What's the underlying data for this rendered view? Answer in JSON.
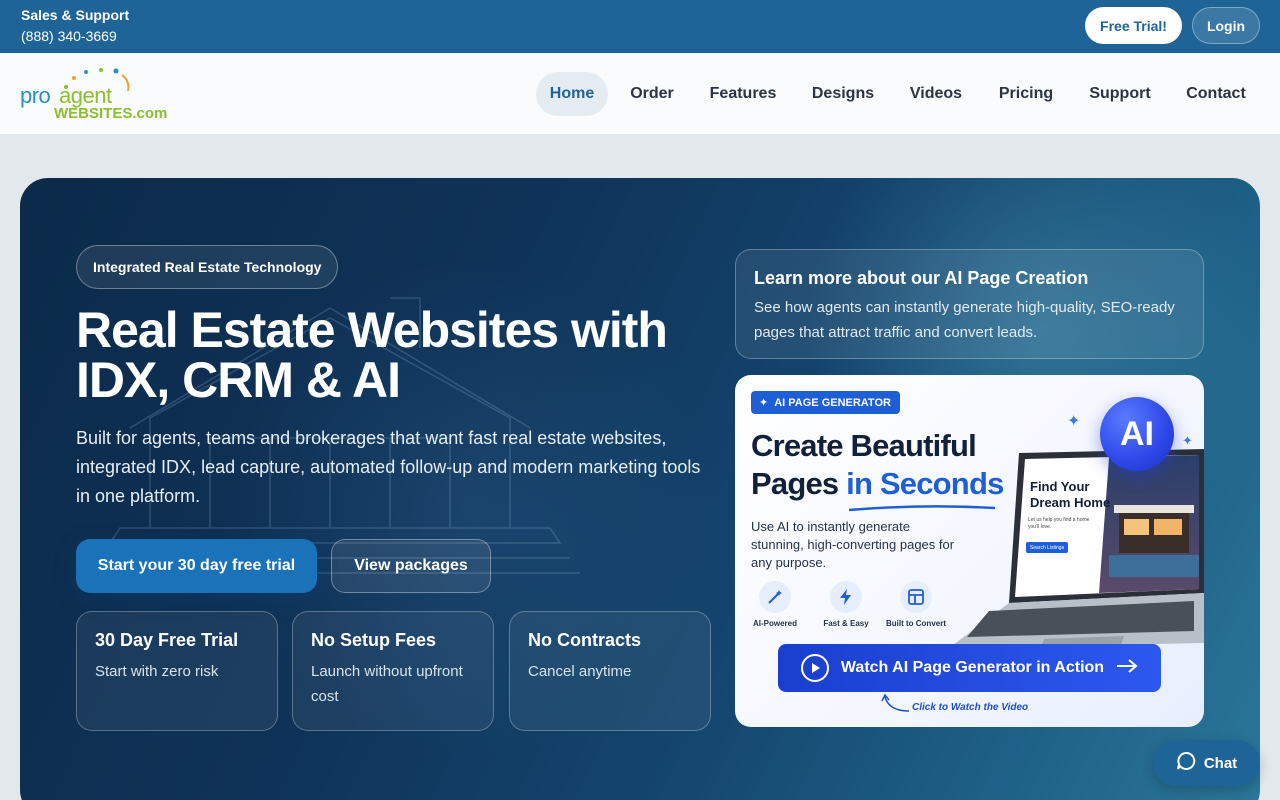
{
  "topbar": {
    "sales_label": "Sales & Support",
    "phone": "(888) 340-3669",
    "trial_button": "Free Trial!",
    "login_button": "Login"
  },
  "logo": {
    "pro": "pro",
    "agent": "agent",
    "websites": "WEBSITES.com"
  },
  "nav": {
    "items": [
      "Home",
      "Order",
      "Features",
      "Designs",
      "Videos",
      "Pricing",
      "Support",
      "Contact"
    ],
    "active": "Home"
  },
  "hero": {
    "pill": "Integrated Real Estate Technology",
    "title_line1": "Real Estate Websites with",
    "title_line2": "IDX, CRM & AI",
    "lead": "Built for agents, teams and brokerages that want fast real estate websites, integrated IDX, lead capture, automated follow-up and modern marketing tools in one platform.",
    "cta_primary": "Start your 30 day free trial",
    "cta_secondary": "View packages",
    "features": [
      {
        "title": "30 Day Free Trial",
        "desc": "Start with zero risk"
      },
      {
        "title": "No Setup Fees",
        "desc": "Launch without upfront cost"
      },
      {
        "title": "No Contracts",
        "desc": "Cancel anytime"
      }
    ]
  },
  "learn": {
    "title": "Learn more about our AI Page Creation",
    "desc": "See how agents can instantly generate high-quality, SEO-ready pages that attract traffic and convert leads."
  },
  "promo": {
    "badge": "AI PAGE GENERATOR",
    "headline_line1": "Create Beautiful",
    "headline_line2a": "Pages ",
    "headline_line2b": "in Seconds",
    "desc": "Use AI to instantly generate stunning, high-converting pages for any purpose.",
    "features": [
      "AI-Powered",
      "Fast & Easy",
      "Built to Convert"
    ],
    "ai_badge": "AI",
    "screen_title_line1": "Find Your",
    "screen_title_line2": "Dream Home",
    "screen_sub": "Let us help you find a home you'll love.",
    "screen_button": "Search Listings",
    "watch_button": "Watch AI Page Generator in Action",
    "click_hint": "Click to Watch the Video"
  },
  "chat": {
    "label": "Chat"
  },
  "colors": {
    "topbar": "#1e6496",
    "accent_blue": "#1f5fd6",
    "logo_green": "#8bbf2f",
    "logo_blue": "#2a8fbf"
  }
}
